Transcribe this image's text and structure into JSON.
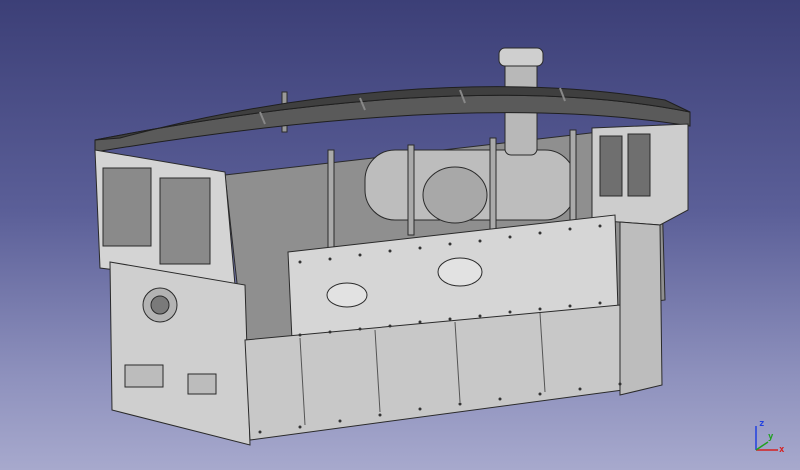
{
  "viewport": {
    "background_top": "#3c3f77",
    "background_bottom": "#a7a9cd",
    "model_fill": "#c7c7c7",
    "model_edge": "#2a2a2a",
    "roof_fill": "#4a4a4a"
  },
  "axis_indicator": {
    "x_label": "x",
    "y_label": "y",
    "z_label": "z",
    "x_color": "#d62020",
    "y_color": "#20a020",
    "z_color": "#2040e0"
  }
}
